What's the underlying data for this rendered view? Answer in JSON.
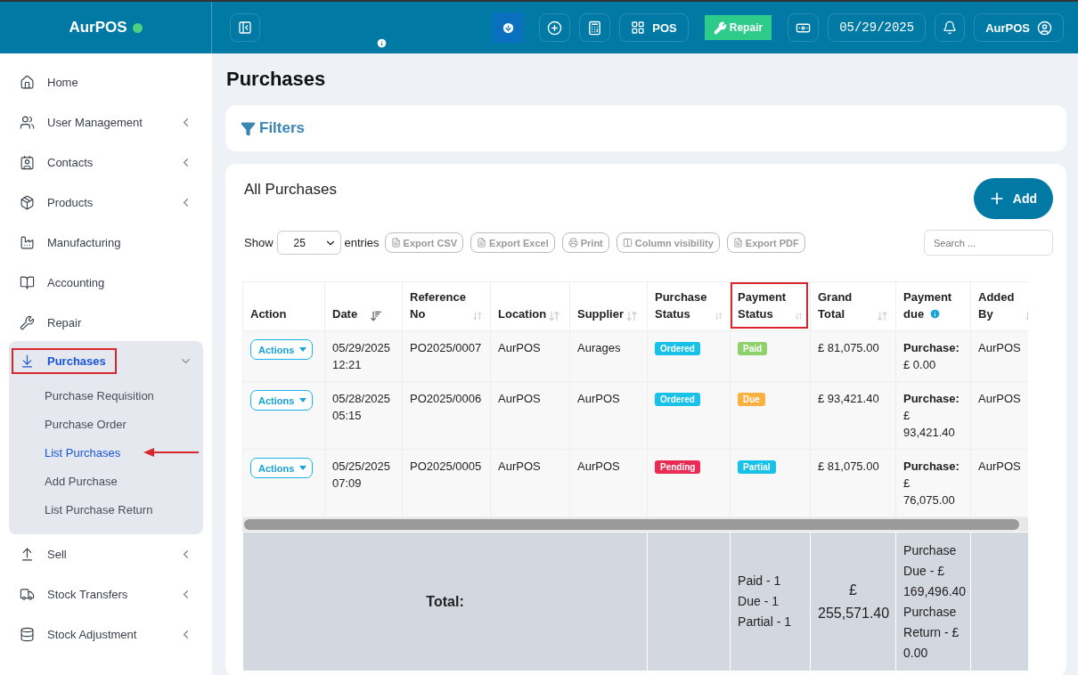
{
  "brand": {
    "name": "AurPOS",
    "online": true
  },
  "topbar": {
    "pos_label": "POS",
    "repair_label": "Repair",
    "date": "05/29/2025",
    "user": "AurPOS"
  },
  "sidebar": {
    "items": [
      {
        "label": "Home",
        "has_submenu": false,
        "expanded": false,
        "selected": false,
        "annotated": false
      },
      {
        "label": "User Management",
        "has_submenu": true,
        "expanded": false,
        "selected": false,
        "annotated": false
      },
      {
        "label": "Contacts",
        "has_submenu": true,
        "expanded": false,
        "selected": false,
        "annotated": false
      },
      {
        "label": "Products",
        "has_submenu": true,
        "expanded": false,
        "selected": false,
        "annotated": false
      },
      {
        "label": "Manufacturing",
        "has_submenu": false,
        "expanded": false,
        "selected": false,
        "annotated": false
      },
      {
        "label": "Accounting",
        "has_submenu": false,
        "expanded": false,
        "selected": false,
        "annotated": false
      },
      {
        "label": "Repair",
        "has_submenu": false,
        "expanded": false,
        "selected": false,
        "annotated": false
      },
      {
        "label": "Purchases",
        "has_submenu": true,
        "expanded": true,
        "selected": true,
        "annotated": true,
        "children": [
          {
            "label": "Purchase Requisition",
            "selected": false,
            "arrow": false
          },
          {
            "label": "Purchase Order",
            "selected": false,
            "arrow": false
          },
          {
            "label": "List Purchases",
            "selected": true,
            "arrow": true
          },
          {
            "label": "Add Purchase",
            "selected": false,
            "arrow": false
          },
          {
            "label": "List Purchase Return",
            "selected": false,
            "arrow": false
          }
        ]
      },
      {
        "label": "Sell",
        "has_submenu": true,
        "expanded": false,
        "selected": false,
        "annotated": false
      },
      {
        "label": "Stock Transfers",
        "has_submenu": true,
        "expanded": false,
        "selected": false,
        "annotated": false
      },
      {
        "label": "Stock Adjustment",
        "has_submenu": true,
        "expanded": false,
        "selected": false,
        "annotated": false
      }
    ]
  },
  "page_title": "Purchases",
  "filters": {
    "label": "Filters"
  },
  "card": {
    "title": "All Purchases",
    "add_label": "Add"
  },
  "toolbar": {
    "show_label": "Show",
    "page_size": "25",
    "entries_label": "entries",
    "buttons": [
      {
        "label": "Export CSV"
      },
      {
        "label": "Export Excel"
      },
      {
        "label": "Print"
      },
      {
        "label": "Column visibility"
      },
      {
        "label": "Export PDF"
      }
    ],
    "search_placeholder": "Search ..."
  },
  "table": {
    "columns": [
      {
        "label": "Action",
        "sortable": false,
        "sorted": false,
        "annotated": false,
        "info": false
      },
      {
        "label": "Date",
        "sortable": true,
        "sorted": true,
        "annotated": false,
        "info": false
      },
      {
        "label": "Reference No",
        "sortable": true,
        "sorted": false,
        "annotated": false,
        "info": false
      },
      {
        "label": "Location",
        "sortable": true,
        "sorted": false,
        "annotated": false,
        "info": false
      },
      {
        "label": "Supplier",
        "sortable": true,
        "sorted": false,
        "annotated": false,
        "info": false
      },
      {
        "label": "Purchase Status",
        "sortable": true,
        "sorted": false,
        "annotated": false,
        "info": false
      },
      {
        "label": "Payment Status",
        "sortable": true,
        "sorted": false,
        "annotated": true,
        "info": false
      },
      {
        "label": "Grand Total",
        "sortable": true,
        "sorted": false,
        "annotated": false,
        "info": false
      },
      {
        "label": "Payment due",
        "sortable": false,
        "sorted": false,
        "annotated": false,
        "info": true
      },
      {
        "label": "Added By",
        "sortable": true,
        "sorted": false,
        "annotated": false,
        "info": false
      }
    ],
    "rows": [
      {
        "action": "Actions",
        "date": "05/29/2025 12:21",
        "reference": "PO2025/0007",
        "location": "AurPOS",
        "supplier": "Aurages",
        "purchase_status": {
          "label": "Ordered",
          "color": "#17c1e8"
        },
        "payment_status": {
          "label": "Paid",
          "color": "#8fd16b"
        },
        "grand_total": "£ 81,075.00",
        "due_label": "Purchase:",
        "due_amount": "£ 0.00",
        "added_by": "AurPOS"
      },
      {
        "action": "Actions",
        "date": "05/28/2025 05:15",
        "reference": "PO2025/0006",
        "location": "AurPOS",
        "supplier": "AurPOS",
        "purchase_status": {
          "label": "Ordered",
          "color": "#17c1e8"
        },
        "payment_status": {
          "label": "Due",
          "color": "#fbb040"
        },
        "grand_total": "£ 93,421.40",
        "due_label": "Purchase:",
        "due_amount": "£ 93,421.40",
        "added_by": "AurPOS"
      },
      {
        "action": "Actions",
        "date": "05/25/2025 07:09",
        "reference": "PO2025/0005",
        "location": "AurPOS",
        "supplier": "AurPOS",
        "purchase_status": {
          "label": "Pending",
          "color": "#ea2c54"
        },
        "payment_status": {
          "label": "Partial",
          "color": "#17c1e8"
        },
        "grand_total": "£ 81,075.00",
        "due_label": "Purchase:",
        "due_amount": "£ 76,075.00",
        "added_by": "AurPOS"
      }
    ],
    "footer": {
      "label": "Total:",
      "payment_counts": [
        "Paid - 1",
        "Due - 1",
        "Partial - 1"
      ],
      "grand_total": "£ 255,571.40",
      "payment_due": "Purchase Due - £ 169,496.40 Purchase Return - £ 0.00"
    }
  }
}
